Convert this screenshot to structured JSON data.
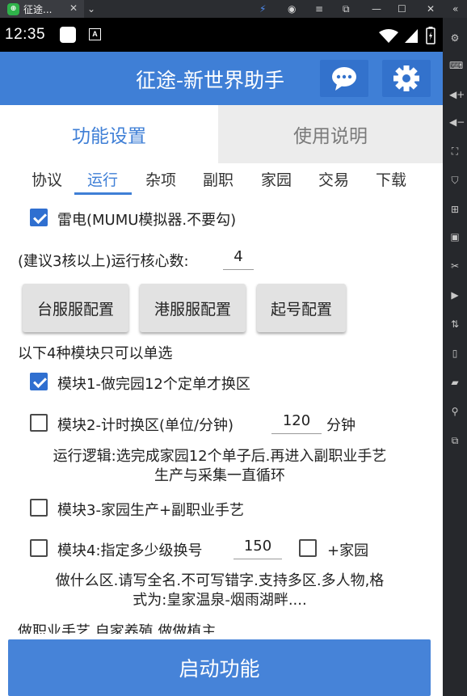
{
  "window": {
    "tab_title": "征途...",
    "app_badge": "⊕"
  },
  "status_bar": {
    "time": "12:35",
    "notif_a": "A"
  },
  "header": {
    "title": "征途-新世界助手"
  },
  "top_tabs": [
    {
      "label": "功能设置",
      "active": true
    },
    {
      "label": "使用说明",
      "active": false
    }
  ],
  "sub_tabs": [
    {
      "label": "协议"
    },
    {
      "label": "运行",
      "active": true
    },
    {
      "label": "杂项"
    },
    {
      "label": "副职"
    },
    {
      "label": "家园"
    },
    {
      "label": "交易"
    },
    {
      "label": "下载"
    }
  ],
  "leidian": {
    "label": "雷电(MUMU模拟器.不要勾)",
    "checked": true
  },
  "cores": {
    "label": "(建议3核以上)运行核心数:",
    "value": "4"
  },
  "config_buttons": [
    {
      "label": "台服服配置"
    },
    {
      "label": "港服服配置"
    },
    {
      "label": "起号配置"
    }
  ],
  "module_note": "以下4种模块只可以单选",
  "module1": {
    "label": "模块1-做完园12个定单才换区",
    "checked": true
  },
  "module2": {
    "label": "模块2-计时换区(单位/分钟)",
    "value": "120",
    "unit": "分钟",
    "checked": false
  },
  "logic_text": {
    "line1": "运行逻辑:选完成家园12个单子后.再进入副职业手艺",
    "line2": "生产与采集一直循环"
  },
  "module3": {
    "label": "模块3-家园生产+副职业手艺",
    "checked": false
  },
  "module4": {
    "label": "模块4:指定多少级换号",
    "value": "150",
    "checked": false
  },
  "home_option": {
    "label": "+家园",
    "checked": false
  },
  "zone_text": {
    "line1": "做什么区.请写全名.不可写错字.支持多区.多人物,格",
    "line2": "式为:皇家温泉-烟雨湖畔...."
  },
  "cut_text": "做职业手艺,自家养殖,做做植主",
  "start_button": "启动功能",
  "colors": {
    "primary": "#3f7fd6",
    "checkbox": "#2f6fd0",
    "tab_inactive_bg": "#ececec"
  }
}
